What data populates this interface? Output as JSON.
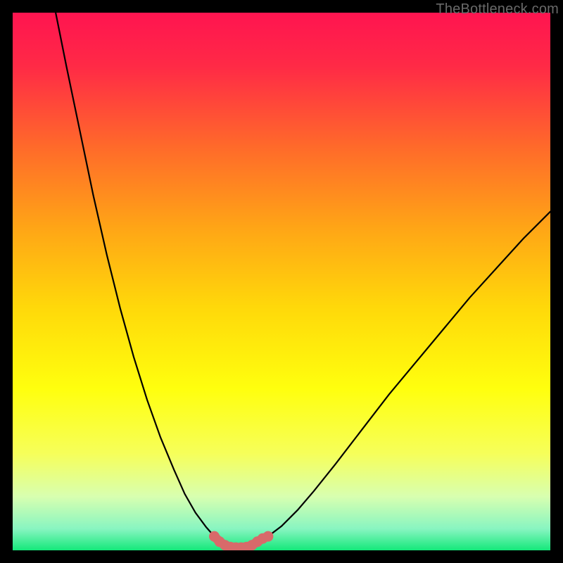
{
  "watermark": "TheBottleneck.com",
  "chart_data": {
    "type": "line",
    "title": "",
    "xlabel": "",
    "ylabel": "",
    "xlim": [
      0,
      100
    ],
    "ylim": [
      0,
      100
    ],
    "grid": false,
    "legend": false,
    "gradient_stops": [
      {
        "offset": 0.0,
        "color": "#ff1450"
      },
      {
        "offset": 0.1,
        "color": "#ff2a46"
      },
      {
        "offset": 0.25,
        "color": "#ff6a2a"
      },
      {
        "offset": 0.4,
        "color": "#ffa516"
      },
      {
        "offset": 0.55,
        "color": "#ffd90a"
      },
      {
        "offset": 0.7,
        "color": "#ffff0e"
      },
      {
        "offset": 0.82,
        "color": "#f6ff5a"
      },
      {
        "offset": 0.9,
        "color": "#d8ffb0"
      },
      {
        "offset": 0.96,
        "color": "#88f5c1"
      },
      {
        "offset": 1.0,
        "color": "#14e87a"
      }
    ],
    "series": [
      {
        "name": "left_curve",
        "color": "#000000",
        "x": [
          8.0,
          10.0,
          12.5,
          15.0,
          17.5,
          20.0,
          22.5,
          25.0,
          27.5,
          30.0,
          32.0,
          34.0,
          36.0,
          37.5
        ],
        "y": [
          100.0,
          90.0,
          78.0,
          66.0,
          55.0,
          45.0,
          36.0,
          28.0,
          21.0,
          15.0,
          10.5,
          7.0,
          4.3,
          2.6
        ]
      },
      {
        "name": "right_curve",
        "color": "#000000",
        "x": [
          47.5,
          50.0,
          53.0,
          56.0,
          60.0,
          65.0,
          70.0,
          75.0,
          80.0,
          85.0,
          90.0,
          95.0,
          100.0
        ],
        "y": [
          2.6,
          4.5,
          7.5,
          11.0,
          16.0,
          22.5,
          29.0,
          35.0,
          41.0,
          47.0,
          52.5,
          58.0,
          63.0
        ]
      },
      {
        "name": "bottom_highlight",
        "color": "#d86a6a",
        "x": [
          37.5,
          38.5,
          39.5,
          40.5,
          41.5,
          42.5,
          43.5,
          44.5,
          45.5,
          46.5,
          47.5
        ],
        "y": [
          2.6,
          1.6,
          0.95,
          0.6,
          0.5,
          0.5,
          0.6,
          0.95,
          1.6,
          2.2,
          2.6
        ]
      }
    ],
    "annotations": []
  }
}
